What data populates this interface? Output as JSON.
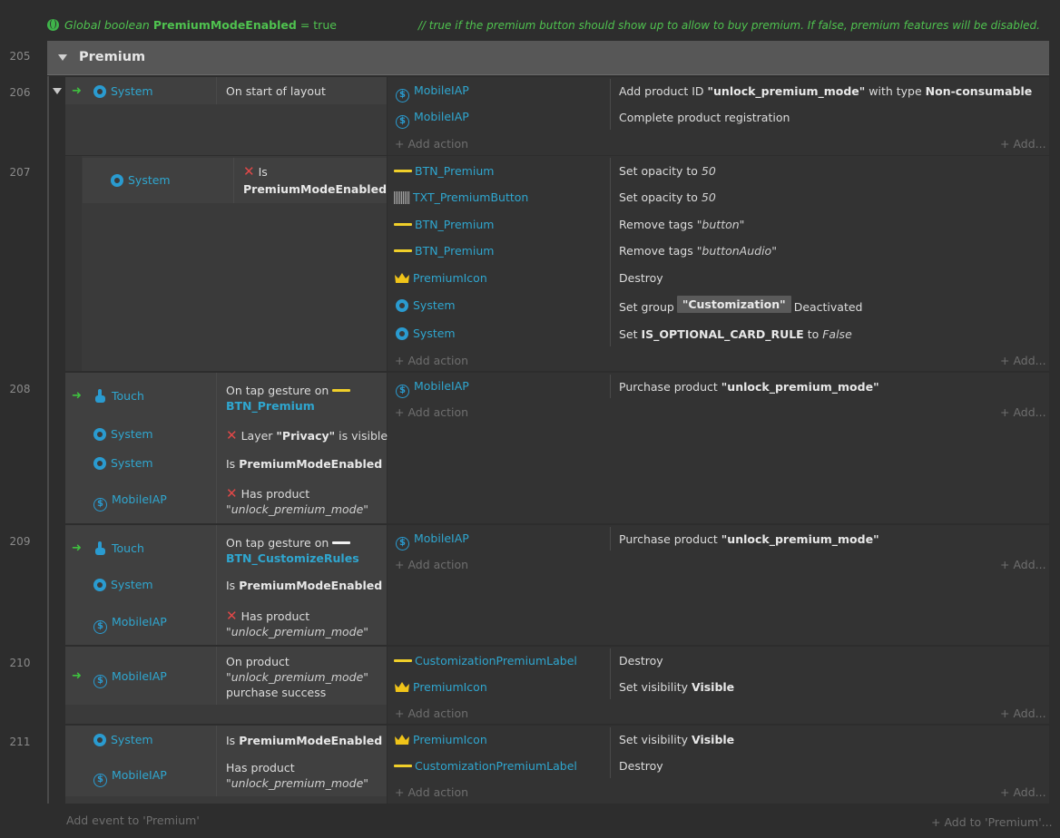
{
  "global_var": {
    "prefix": "Global boolean",
    "name": "PremiumModeEnabled",
    "value_text": "= true",
    "comment": "//  true if the premium button should show up to allow to buy premium. If false, premium features will be disabled."
  },
  "group": {
    "line": "205",
    "title": "Premium"
  },
  "labels": {
    "add_action": "Add action",
    "add_more": "Add...",
    "add_event": "Add event to 'Premium'",
    "add_to": "Add to 'Premium'..."
  },
  "ev206": {
    "line": "206",
    "cond_obj": "System",
    "cond_text": "On start of layout",
    "a1_obj": "MobileIAP",
    "a1_pre": "Add product ID ",
    "a1_b1": "\"unlock_premium_mode\"",
    "a1_mid": " with type ",
    "a1_b2": "Non-consumable",
    "a2_obj": "MobileIAP",
    "a2_text": "Complete product registration"
  },
  "ev207": {
    "line": "207",
    "cond_obj": "System",
    "cond_is": "Is",
    "cond_b": "PremiumModeEnabled",
    "a1_obj": "BTN_Premium",
    "a1_pre": "Set opacity to ",
    "a1_i": "50",
    "a2_obj": "TXT_PremiumButton",
    "a2_pre": "Set opacity to ",
    "a2_i": "50",
    "a3_obj": "BTN_Premium",
    "a3_pre": "Remove tags ",
    "a3_i": "\"button\"",
    "a4_obj": "BTN_Premium",
    "a4_pre": "Remove tags ",
    "a4_i": "\"buttonAudio\"",
    "a5_obj": "PremiumIcon",
    "a5_text": "Destroy",
    "a6_obj": "System",
    "a6_pre": "Set group",
    "a6_param": "\"Customization\"",
    "a6_post": "Deactivated",
    "a7_obj": "System",
    "a7_pre": "Set ",
    "a7_b": "IS_OPTIONAL_CARD_RULE",
    "a7_mid": " to ",
    "a7_i": "False"
  },
  "ev208": {
    "line": "208",
    "c1_obj": "Touch",
    "c1_pre": "On tap gesture on",
    "c1_b": "BTN_Premium",
    "c2_obj": "System",
    "c2_pre": "Layer ",
    "c2_b": "\"Privacy\"",
    "c2_post": " is visible",
    "c3_obj": "System",
    "c3_pre": "Is ",
    "c3_b": "PremiumModeEnabled",
    "c4_obj": "MobileIAP",
    "c4_pre": "Has product",
    "c4_i": "\"unlock_premium_mode\"",
    "a1_obj": "MobileIAP",
    "a1_pre": "Purchase product ",
    "a1_b": "\"unlock_premium_mode\""
  },
  "ev209": {
    "line": "209",
    "c1_obj": "Touch",
    "c1_pre": "On tap gesture on",
    "c1_b": "BTN_CustomizeRules",
    "c2_obj": "System",
    "c2_pre": "Is ",
    "c2_b": "PremiumModeEnabled",
    "c3_obj": "MobileIAP",
    "c3_pre": "Has product",
    "c3_i": "\"unlock_premium_mode\"",
    "a1_obj": "MobileIAP",
    "a1_pre": "Purchase product ",
    "a1_b": "\"unlock_premium_mode\""
  },
  "ev210": {
    "line": "210",
    "c1_obj": "MobileIAP",
    "c1_l1": "On product",
    "c1_l2": "\"unlock_premium_mode\"",
    "c1_l3": "purchase success",
    "a1_obj": "CustomizationPremiumLabel",
    "a1_text": "Destroy",
    "a2_obj": "PremiumIcon",
    "a2_pre": "Set visibility ",
    "a2_b": "Visible"
  },
  "ev211": {
    "line": "211",
    "c1_obj": "System",
    "c1_pre": "Is ",
    "c1_b": "PremiumModeEnabled",
    "c2_obj": "MobileIAP",
    "c2_pre": "Has product",
    "c2_i": "\"unlock_premium_mode\"",
    "a1_obj": "PremiumIcon",
    "a1_pre": "Set visibility ",
    "a1_b": "Visible",
    "a2_obj": "CustomizationPremiumLabel",
    "a2_text": "Destroy"
  },
  "icons": {
    "system": "gear-icon",
    "iap": "dollar-circle-icon",
    "touch": "touch-hand-icon",
    "sprite": "sprite-bar-icon",
    "crown": "crown-icon",
    "text": "text-object-icon",
    "invert": "x-mark-icon",
    "trigger": "trigger-arrow-icon"
  }
}
